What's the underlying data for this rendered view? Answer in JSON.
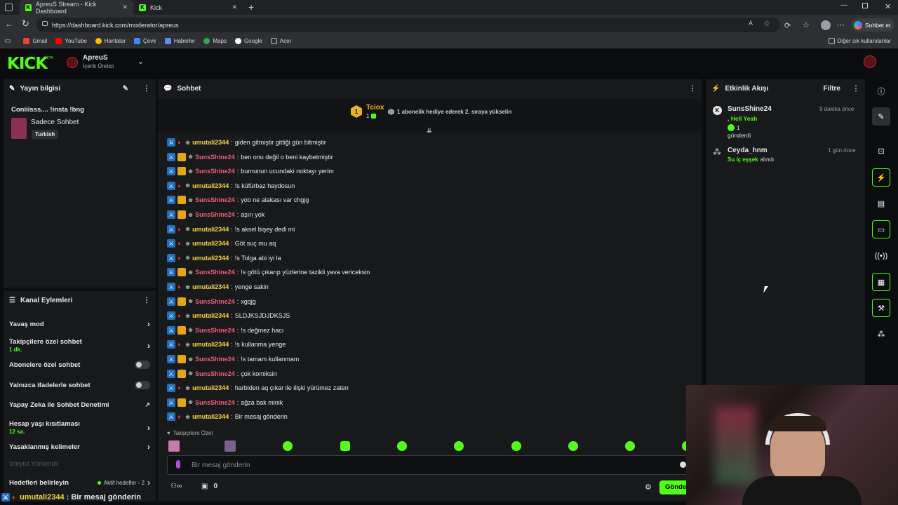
{
  "browser": {
    "tabs": [
      {
        "title": "ApreuS Stream - Kick Dashboard"
      },
      {
        "title": "Kick"
      }
    ],
    "url": "https://dashboard.kick.com/moderator/apreus",
    "copilot_label": "Sohbet et",
    "bookmarks": [
      "Gmail",
      "YouTube",
      "Haritalar",
      "Çevir",
      "Haberler",
      "Maps",
      "Google",
      "Acer"
    ],
    "other_bookmarks": "Diğer sık kullanılanlar"
  },
  "header": {
    "logo": "KICK",
    "beta": "BETA",
    "channel_name": "ApreuS",
    "channel_role": "İçerik Üretici"
  },
  "stream_info": {
    "title": "Yayın bilgisi",
    "stream_title": "Coniiisss.... !insta !bng",
    "category": "Sadece Sohbet",
    "tag": "Turkish"
  },
  "channel_actions": {
    "title": "Kanal Eylemleri",
    "items": [
      {
        "label": "Yavaş mod",
        "sub": ""
      },
      {
        "label": "Takipçilere özel sohbet",
        "sub": "1 dk."
      },
      {
        "label": "Abonelere özel sohbet",
        "sub": ""
      },
      {
        "label": "Yalnızca ifadelerle sohbet",
        "sub": ""
      },
      {
        "label": "Yapay Zeka ile Sohbet Denetimi",
        "sub": ""
      },
      {
        "label": "Hesap yaşı kısıtlaması",
        "sub": "12 sa."
      },
      {
        "label": "Yasaklanmış kelimeler",
        "sub": ""
      },
      {
        "label": "İzleyici Yönlendir",
        "sub": ""
      },
      {
        "label": "Hedefleri belirleyin",
        "sub": "Aktif hedefler - 2"
      }
    ]
  },
  "chat": {
    "title": "Sohbet",
    "pinned": {
      "user": "Tciox",
      "rank": "1",
      "count": "1",
      "text": "1 abonelik hediye ederek 2. sıraya yükselin"
    },
    "messages": [
      {
        "user": "umutali2344",
        "text": "giden gitmiştir gittiği gün bitmiştir",
        "color": "#f5d547"
      },
      {
        "user": "SunsShine24",
        "text": "ben onu değil o beni kaybetmiştir",
        "color": "#ee5e74"
      },
      {
        "user": "SunsShine24",
        "text": "burnunun ucundaki noktayı yerim",
        "color": "#ee5e74"
      },
      {
        "user": "umutali2344",
        "text": "!s küfürbaz haydosun",
        "color": "#f5d547"
      },
      {
        "user": "SunsShine24",
        "text": "yoo ne alakası var chgjg",
        "color": "#ee5e74"
      },
      {
        "user": "SunsShine24",
        "text": "aşırı yok",
        "color": "#ee5e74"
      },
      {
        "user": "umutali2344",
        "text": "!s aksel bişey dedi mi",
        "color": "#f5d547"
      },
      {
        "user": "umutali2344",
        "text": "Göt suç mu aq",
        "color": "#f5d547"
      },
      {
        "user": "umutali2344",
        "text": "!s Tolga abi iyi la",
        "color": "#f5d547"
      },
      {
        "user": "SunsShine24",
        "text": "!s götü çıkarıp yüzlerine tazikli yava vericeksin",
        "color": "#ee5e74"
      },
      {
        "user": "umutali2344",
        "text": "yenge sakin",
        "color": "#f5d547"
      },
      {
        "user": "SunsShine24",
        "text": "xgqjg",
        "color": "#ee5e74"
      },
      {
        "user": "umutali2344",
        "text": "SLDJKSJDJDKSJS",
        "color": "#f5d547"
      },
      {
        "user": "SunsShine24",
        "text": "!s değmez hacı",
        "color": "#ee5e74"
      },
      {
        "user": "umutali2344",
        "text": "!s kullanma yenge",
        "color": "#f5d547"
      },
      {
        "user": "SunsShine24",
        "text": "!s tamam kullanmam",
        "color": "#ee5e74"
      },
      {
        "user": "SunsShine24",
        "text": "çok komiksin",
        "color": "#ee5e74"
      },
      {
        "user": "umutali2344",
        "text": "harbiden aq çıkar ile ilişki yürümez zaten",
        "color": "#f5d547"
      },
      {
        "user": "SunsShine24",
        "text": "ağza bak minik",
        "color": "#ee5e74"
      },
      {
        "user": "umutali2344",
        "text": "Bir mesaj gönderin",
        "color": "#f5d547"
      }
    ],
    "followers_only": "Takipçilere Özel",
    "input_placeholder": "Bir mesaj gönderin",
    "viewer_count": "0",
    "send_label": "Gönder"
  },
  "activity": {
    "title": "Etkinlik Akışı",
    "filter_label": "Filtre",
    "events": [
      {
        "user": "SunsShine24",
        "time": "9 dakika önce",
        "highlight": ", Hell Yeah",
        "count": "1",
        "action": "gönderdi"
      },
      {
        "user": "Ceyda_hnm",
        "time": "1 gün önce",
        "highlight": "Su iç eşşek",
        "action": "alındı"
      }
    ]
  },
  "overlay_text": {
    "user": "umutali2344",
    "text": ": Bir mesaj gönderin"
  },
  "colors": {
    "accent": "#53fc18",
    "panel": "#18191b",
    "bg": "#0b0c0e"
  }
}
